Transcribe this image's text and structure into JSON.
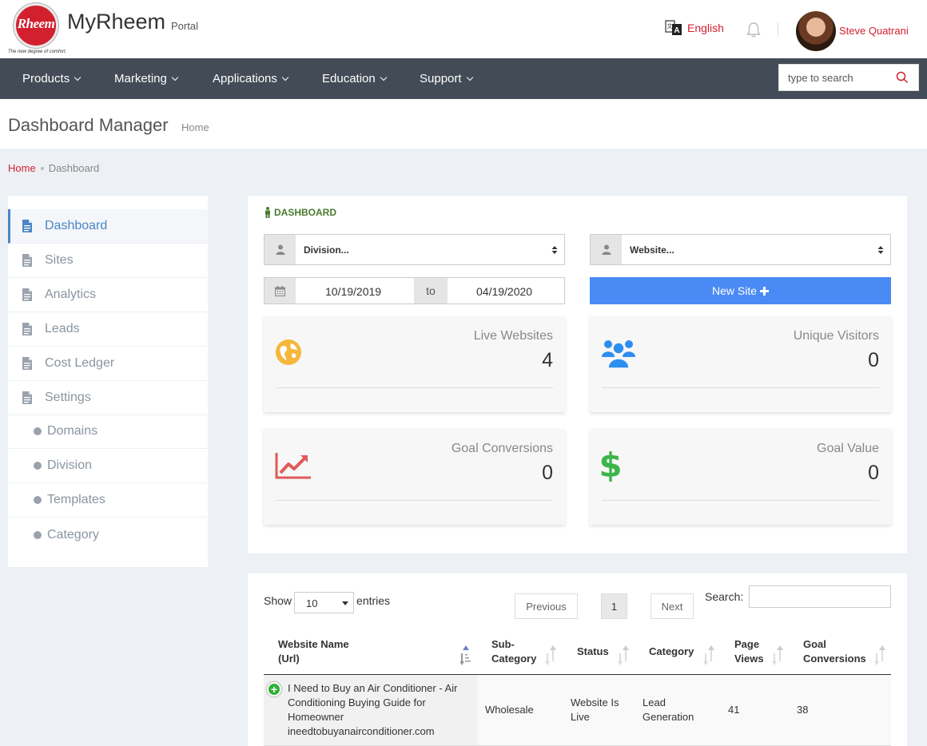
{
  "header": {
    "logo_text": "Rheem",
    "logo_tagline": "The new degree of comfort.",
    "app_title": "MyRheem",
    "app_subtitle": "Portal",
    "language": "English",
    "username": "Steve Quatrani"
  },
  "nav": {
    "items": [
      {
        "label": "Products"
      },
      {
        "label": "Marketing"
      },
      {
        "label": "Applications"
      },
      {
        "label": "Education"
      },
      {
        "label": "Support"
      }
    ],
    "search_placeholder": "type to search"
  },
  "page": {
    "title": "Dashboard Manager",
    "subtitle": "Home",
    "breadcrumb": {
      "home": "Home",
      "current": "Dashboard"
    }
  },
  "sidebar": {
    "items": [
      {
        "label": "Dashboard"
      },
      {
        "label": "Sites"
      },
      {
        "label": "Analytics"
      },
      {
        "label": "Leads"
      },
      {
        "label": "Cost Ledger"
      },
      {
        "label": "Settings"
      }
    ],
    "subitems": [
      {
        "label": "Domains"
      },
      {
        "label": "Division"
      },
      {
        "label": "Templates"
      },
      {
        "label": "Category"
      }
    ]
  },
  "dashboard": {
    "heading": "DASHBOARD",
    "division_select": "Division...",
    "website_select": "Website...",
    "date_from": "10/19/2019",
    "date_to_label": "to",
    "date_to": "04/19/2020",
    "new_site_label": "New Site",
    "stats": [
      {
        "label": "Live Websites",
        "value": "4",
        "icon": "globe-icon",
        "color": "#f5b83d"
      },
      {
        "label": "Unique Visitors",
        "value": "0",
        "icon": "users-icon",
        "color": "#2e8ef0"
      },
      {
        "label": "Goal Conversions",
        "value": "0",
        "icon": "line-chart-icon",
        "color": "#e05a5a"
      },
      {
        "label": "Goal Value",
        "value": "0",
        "icon": "dollar-icon",
        "color": "#3cb54a"
      }
    ]
  },
  "table": {
    "show_label": "Show",
    "entries_value": "10",
    "entries_label": "entries",
    "previous": "Previous",
    "page": "1",
    "next": "Next",
    "search_label": "Search:",
    "columns": [
      "Website Name (Url)",
      "Sub-Category",
      "Status",
      "Category",
      "Page Views",
      "Goal Conversions"
    ],
    "column_lines": [
      [
        "Website Name",
        "(Url)"
      ],
      [
        "Sub-",
        "Category"
      ],
      [
        "Status"
      ],
      [
        "Category"
      ],
      [
        "Page",
        "Views"
      ],
      [
        "Goal",
        "Conversions"
      ]
    ],
    "rows": [
      {
        "name_lines": [
          "I Need to Buy an Air Conditioner - Air",
          "Conditioning Buying Guide for",
          "Homeowner",
          "ineedtobuyanairconditioner.com"
        ],
        "subcategory": "Wholesale",
        "status_lines": [
          "Website Is",
          "Live"
        ],
        "category_lines": [
          "Lead",
          "Generation"
        ],
        "page_views": "41",
        "goal_conversions": "38"
      }
    ]
  }
}
